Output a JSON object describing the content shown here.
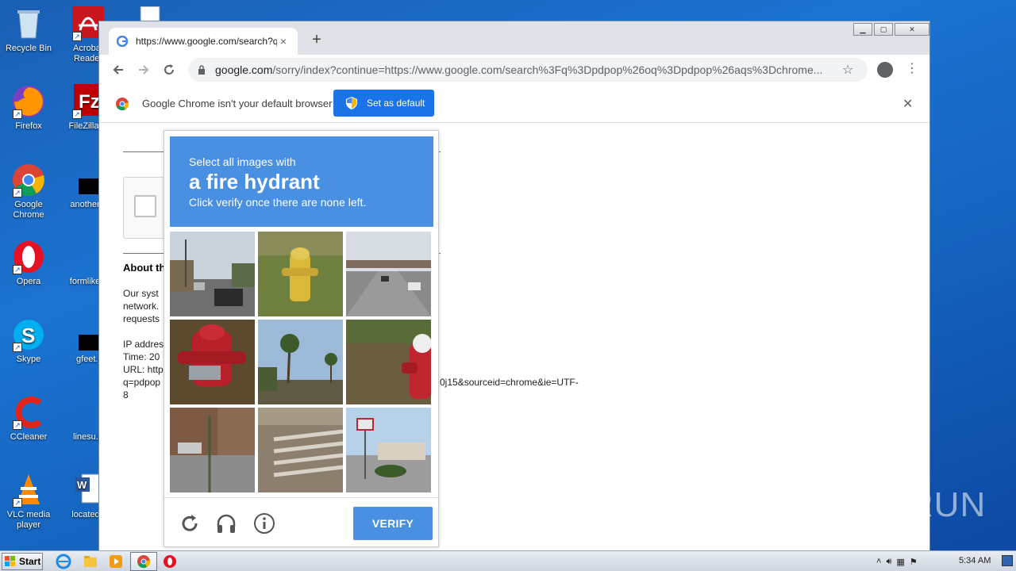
{
  "desktop": {
    "icons": [
      {
        "label": "Recycle Bin"
      },
      {
        "label": "Acrobat Reader"
      },
      {
        "label": "Firefox"
      },
      {
        "label": "FileZilla C"
      },
      {
        "label": "Google Chrome"
      },
      {
        "label": "anotherw"
      },
      {
        "label": "Opera"
      },
      {
        "label": "formlikely"
      },
      {
        "label": "Skype"
      },
      {
        "label": "gfeet.j"
      },
      {
        "label": "CCleaner"
      },
      {
        "label": "linesu.p"
      },
      {
        "label": "VLC media player"
      },
      {
        "label": "locatede"
      }
    ],
    "watermark": "ANY RUN"
  },
  "browser": {
    "tab_title": "https://www.google.com/search?q=",
    "tab_close": "×",
    "new_tab": "+",
    "url_host": "google.com",
    "url_rest": "/sorry/index?continue=https://www.google.com/search%3Fq%3Dpdpop%26oq%3Dpdpop%26aqs%3Dchrome...",
    "infobar_message": "Google Chrome isn't your default browser",
    "set_default_label": "Set as default",
    "infobar_close": "✕"
  },
  "page": {
    "about_heading": "About th",
    "lines": [
      "Our syst",
      "network.",
      "requests",
      "IP addres",
      "Time: 20",
      "URL: http",
      "q=pdpop",
      "8"
    ],
    "url_tail": "0j15&sourceid=chrome&ie=UTF-"
  },
  "captcha": {
    "instruction_line1": "Select all images with",
    "target": "a fire hydrant",
    "instruction_line3": "Click verify once there are none left.",
    "verify_label": "VERIFY",
    "tiles": [
      {
        "name": "street-traffic"
      },
      {
        "name": "yellow-hydrant"
      },
      {
        "name": "highway-overpass"
      },
      {
        "name": "red-hydrant"
      },
      {
        "name": "palm-trees"
      },
      {
        "name": "hydrant-edge"
      },
      {
        "name": "street-corner"
      },
      {
        "name": "crosswalk"
      },
      {
        "name": "gas-station"
      }
    ]
  },
  "taskbar": {
    "start_label": "Start",
    "clock": "5:34 AM"
  }
}
